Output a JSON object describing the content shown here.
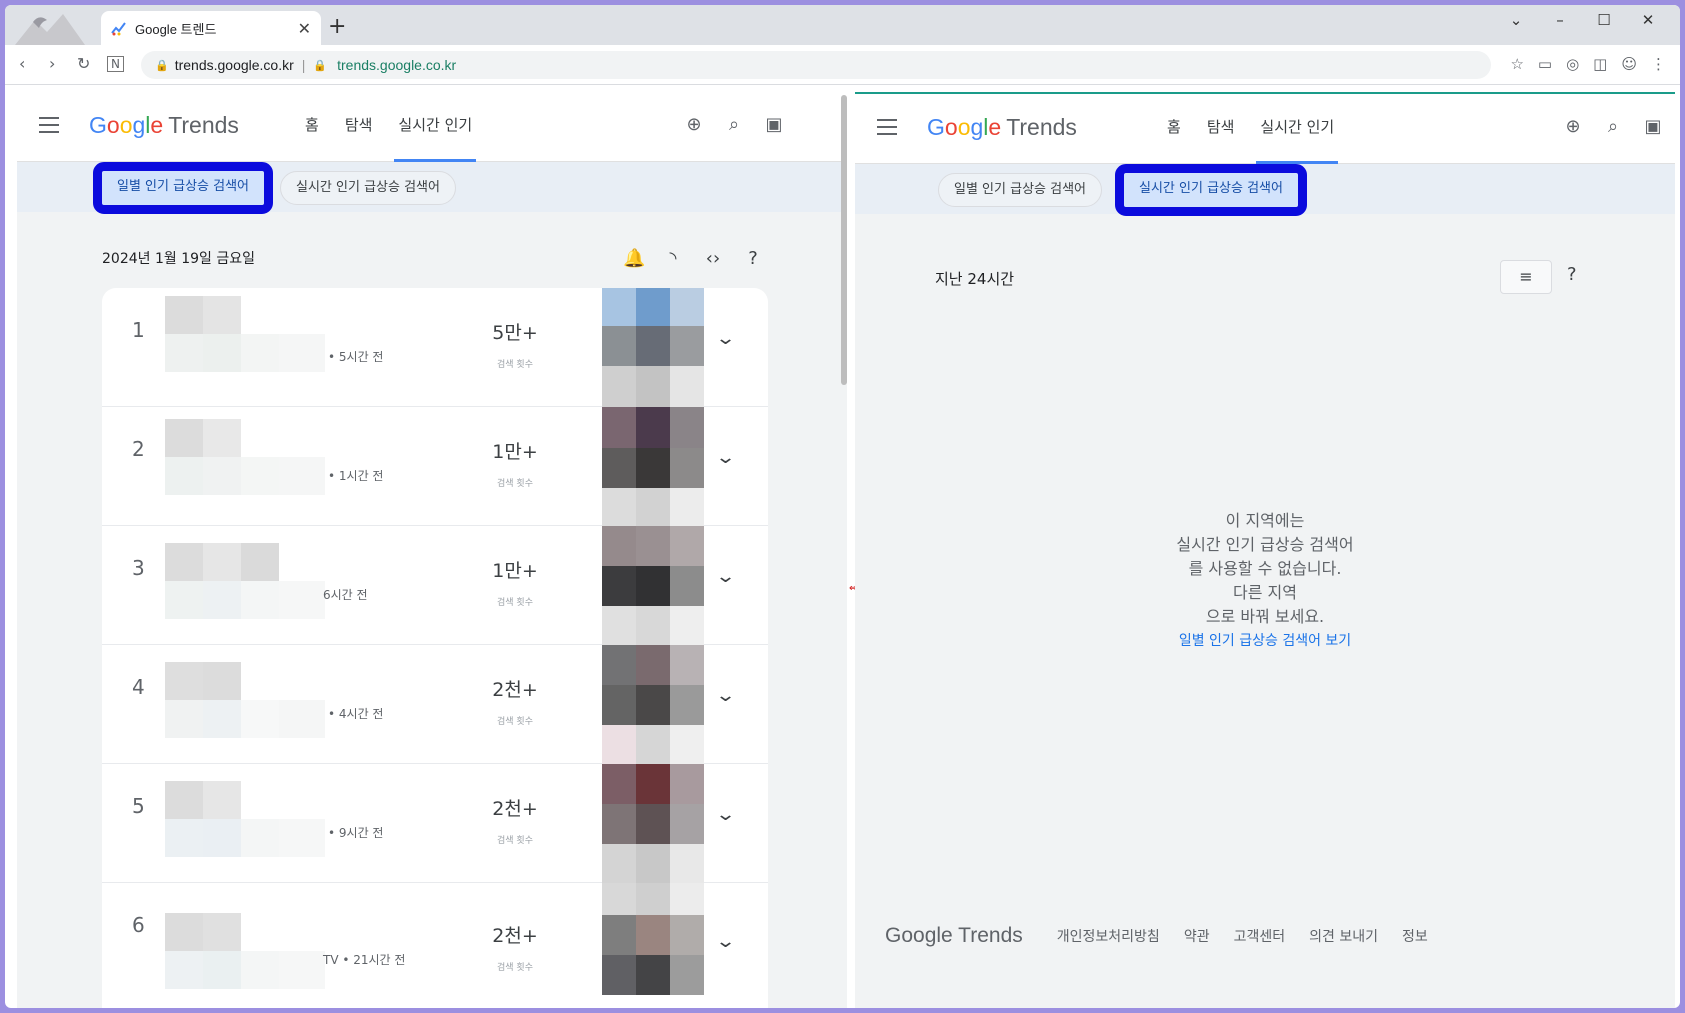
{
  "browser": {
    "tab_title": "Google 트렌드",
    "tab_close": "✕",
    "new_tab": "+",
    "window_controls": [
      "⌄",
      "–",
      "☐",
      "✕"
    ],
    "url_primary": "trends.google.co.kr",
    "url_secondary": "trends.google.co.kr",
    "url_separator": "|"
  },
  "left_pane": {
    "logo_google": [
      "G",
      "o",
      "o",
      "g",
      "l",
      "e"
    ],
    "logo_trends": "Trends",
    "nav": [
      "홈",
      "탐색",
      "실시간 인기"
    ],
    "chips": [
      "일별 인기 급상승 검색어",
      "실시간 인기 급상승 검색어"
    ],
    "date": "2024년 1월 19일 금요일",
    "rows": [
      {
        "rank": "1",
        "time": "• 5시간 전",
        "count": "5만+",
        "count_label": "검색 횟수"
      },
      {
        "rank": "2",
        "time": "• 1시간 전",
        "count": "1만+",
        "count_label": "검색 횟수"
      },
      {
        "rank": "3",
        "time": "6시간 전",
        "count": "1만+",
        "count_label": "검색 횟수"
      },
      {
        "rank": "4",
        "time": "• 4시간 전",
        "count": "2천+",
        "count_label": "검색 횟수"
      },
      {
        "rank": "5",
        "time": "• 9시간 전",
        "count": "2천+",
        "count_label": "검색 횟수"
      },
      {
        "rank": "6",
        "time": "TV • 21시간 전",
        "count": "2천+",
        "count_label": "검색 횟수"
      }
    ]
  },
  "right_pane": {
    "logo_trends": "Trends",
    "nav": [
      "홈",
      "탐색",
      "실시간 인기"
    ],
    "chips": [
      "일별 인기 급상승 검색어",
      "실시간 인기 급상승 검색어"
    ],
    "window_label": "지난 24시간",
    "empty_lines": [
      "이 지역에는",
      "실시간 인기 급상승 검색어",
      "를 사용할 수 없습니다.",
      "다른 지역",
      "으로 바꿔 보세요."
    ],
    "empty_link": "일별 인기 급상승 검색어 보기",
    "footer_logo": "Google Trends",
    "footer_links": [
      "개인정보처리방침",
      "약관",
      "고객센터",
      "의견 보내기",
      "정보"
    ]
  },
  "colors": {
    "highlight_box": "#0b0bdd",
    "active_tab_underline": "#4285f4",
    "link": "#1a73e8"
  }
}
